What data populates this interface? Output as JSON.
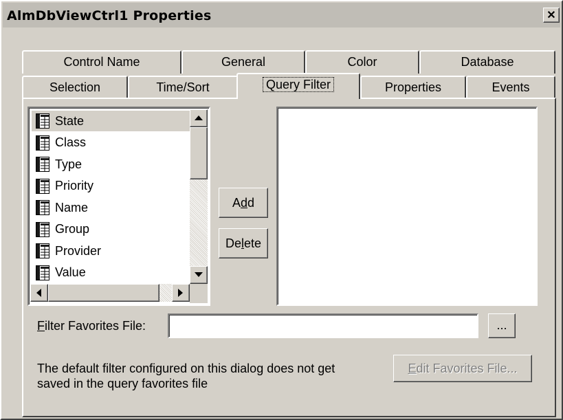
{
  "window": {
    "title": "AlmDbViewCtrl1 Properties",
    "close_glyph": "✕"
  },
  "tabs_back": [
    {
      "label": "Control Name"
    },
    {
      "label": "General"
    },
    {
      "label": "Color"
    },
    {
      "label": "Database"
    }
  ],
  "tabs_front": [
    {
      "label": "Selection"
    },
    {
      "label": "Time/Sort"
    },
    {
      "label": "Query Filter",
      "active": true
    },
    {
      "label": "Properties"
    },
    {
      "label": "Events"
    }
  ],
  "fields_list": {
    "items": [
      {
        "label": "State",
        "selected": true
      },
      {
        "label": "Class"
      },
      {
        "label": "Type"
      },
      {
        "label": "Priority"
      },
      {
        "label": "Name"
      },
      {
        "label": "Group"
      },
      {
        "label": "Provider"
      },
      {
        "label": "Value"
      }
    ],
    "icon": "table-column-icon"
  },
  "buttons": {
    "add_pre": "A",
    "add_key": "d",
    "add_post": "d",
    "delete_pre": "De",
    "delete_key": "l",
    "delete_post": "ete",
    "browse": "...",
    "edit_key": "E",
    "edit_post": "dit Favorites File..."
  },
  "filter_file": {
    "label_key": "F",
    "label_post": "ilter Favorites File:",
    "value": ""
  },
  "note": {
    "line1": "The default filter configured on this dialog does not get",
    "line2": "saved in the query favorites file"
  }
}
